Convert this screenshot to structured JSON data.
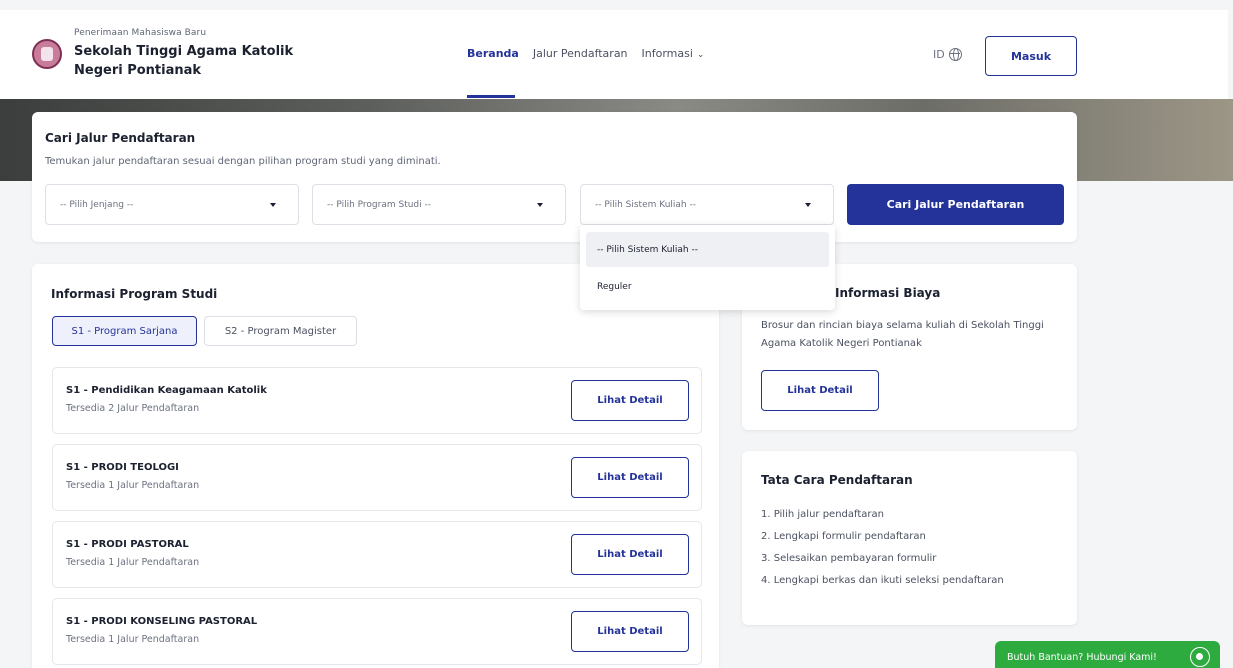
{
  "header": {
    "brand_sub": "Penerimaan Mahasiswa Baru",
    "brand_title": "Sekolah Tinggi Agama Katolik Negeri Pontianak",
    "nav": [
      {
        "label": "Beranda",
        "active": true
      },
      {
        "label": "Jalur Pendaftaran",
        "active": false
      },
      {
        "label": "Informasi",
        "active": false
      }
    ],
    "lang": "ID",
    "login": "Masuk"
  },
  "search": {
    "title": "Cari Jalur Pendaftaran",
    "desc": "Temukan jalur pendaftaran sesuai dengan pilihan program studi yang diminati.",
    "jenjang": "-- Pilih Jenjang --",
    "prodi": "-- Pilih Program Studi --",
    "sistem": "-- Pilih Sistem Kuliah --",
    "button": "Cari Jalur Pendaftaran",
    "dropdown_options": [
      "-- Pilih Sistem Kuliah --",
      "Reguler"
    ]
  },
  "program": {
    "title": "Informasi Program Studi",
    "tabs": [
      "S1 - Program Sarjana",
      "S2 - Program Magister"
    ],
    "rows": [
      {
        "name": "S1 - Pendidikan Keagamaan Katolik",
        "sub": "Tersedia 2 Jalur Pendaftaran",
        "button": "Lihat Detail"
      },
      {
        "name": "S1 - PRODI TEOLOGI",
        "sub": "Tersedia 1 Jalur Pendaftaran",
        "button": "Lihat Detail"
      },
      {
        "name": "S1 - PRODI PASTORAL",
        "sub": "Tersedia 1 Jalur Pendaftaran",
        "button": "Lihat Detail"
      },
      {
        "name": "S1 - PRODI KONSELING PASTORAL",
        "sub": "Tersedia 1 Jalur Pendaftaran",
        "button": "Lihat Detail"
      }
    ]
  },
  "biaya": {
    "title": "Informasi Biaya",
    "desc": "Brosur dan rincian biaya selama kuliah di Sekolah Tinggi Agama Katolik Negeri Pontianak",
    "button": "Lihat Detail"
  },
  "tata": {
    "title": "Tata Cara Pendaftaran",
    "steps": [
      "1. Pilih jalur pendaftaran",
      "2. Lengkapi formulir pendaftaran",
      "3. Selesaikan pembayaran formulir",
      "4. Lengkapi berkas dan ikuti seleksi pendaftaran"
    ]
  },
  "help": {
    "label": "Butuh Bantuan? Hubungi Kami!"
  },
  "colors": {
    "primary": "#24339a",
    "whatsapp": "#2dab3f"
  }
}
